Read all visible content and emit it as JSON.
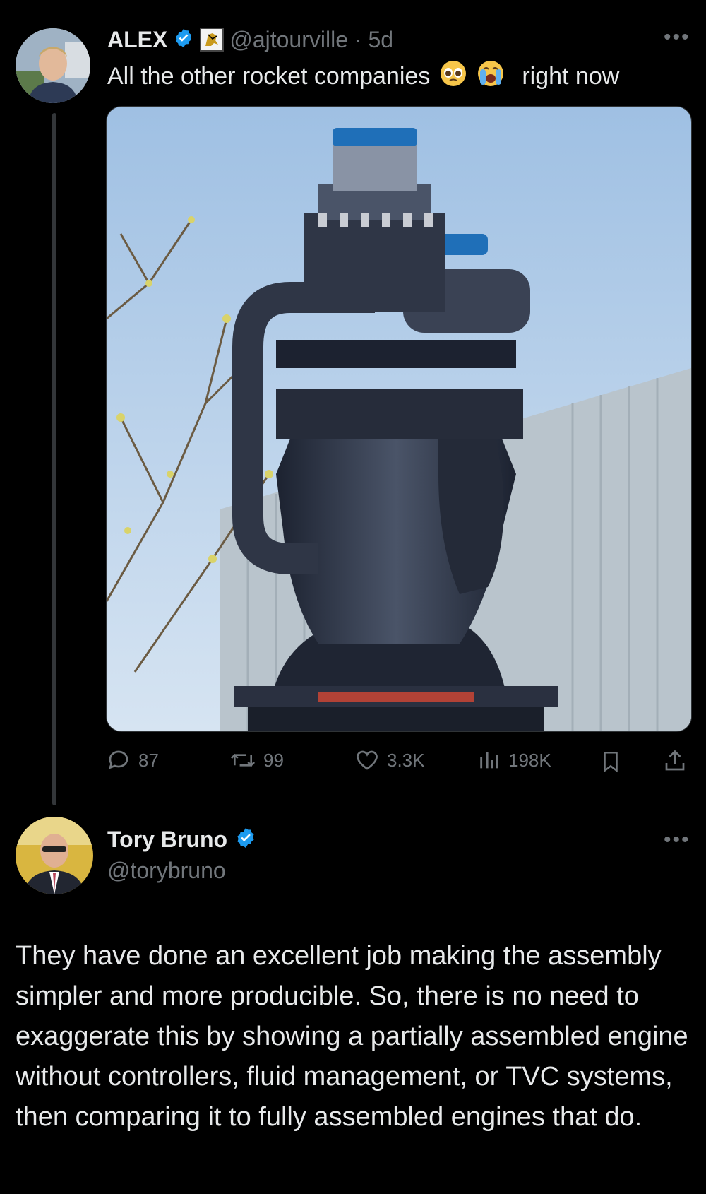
{
  "tweet": {
    "author_name": "ALEX",
    "handle_time": "@ajtourville · 5d",
    "text_before_emoji": "All the other rocket companies",
    "text_after_emoji": "right now",
    "emojis": [
      "pleading-face-emoji",
      "loudly-crying-face-emoji"
    ],
    "image_description_icon": "rocket-engine-photo",
    "actions": {
      "replies": "87",
      "reposts": "99",
      "likes": "3.3K",
      "views": "198K"
    }
  },
  "reply": {
    "author_name": "Tory Bruno",
    "handle": "@torybruno",
    "text": "They have done an excellent job making the assembly simpler and more producible. So, there is no need to exaggerate this by showing a partially assembled engine without controllers, fluid management, or TVC systems, then comparing it to fully assembled engines that do."
  },
  "colors": {
    "background": "#000000",
    "text": "#e7e9ea",
    "muted": "#71767b",
    "verified": "#1d9bf0",
    "thread_line": "#333639"
  }
}
